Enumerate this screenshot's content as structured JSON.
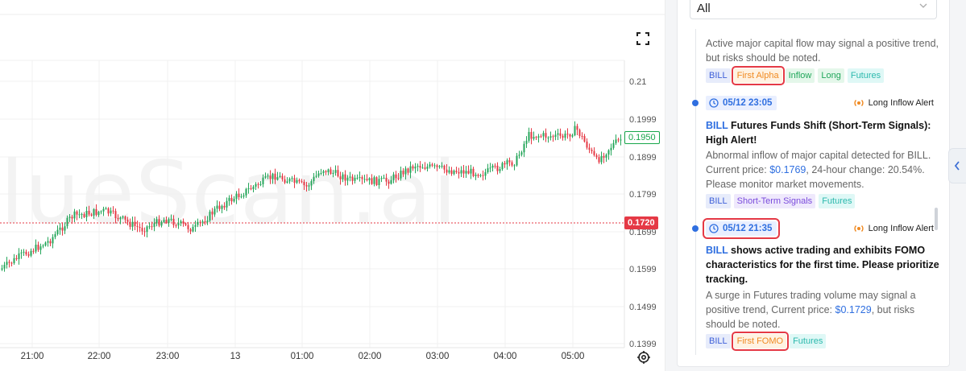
{
  "chart": {
    "price_labels": [
      "0.21",
      "0.1999",
      "0.1899",
      "0.1799",
      "0.1699",
      "0.1599",
      "0.1499",
      "0.1399"
    ],
    "time_labels": [
      "21:00",
      "22:00",
      "23:00",
      "13",
      "01:00",
      "02:00",
      "03:00",
      "04:00",
      "05:00"
    ],
    "current_price": "0.1950",
    "cursor_price": "0.1720",
    "watermark": "lueScan.ai",
    "up_color": "#26a65b",
    "down_color": "#e53945"
  },
  "sidebar": {
    "filter_value": "All",
    "items": [
      {
        "desc": "Active major capital flow may signal a positive trend, but risks should be noted.",
        "tags": [
          "BILL",
          "First Alpha",
          "Inflow",
          "Long",
          "Futures"
        ]
      },
      {
        "time": "05/12 23:05",
        "alert": "Long Inflow Alert",
        "title_symbol": "BILL",
        "title_rest": " Futures Funds Shift (Short-Term Signals): High Alert!",
        "desc_a": "Abnormal inflow of major capital detected for BILL. Current price: ",
        "desc_price": "$0.1769",
        "desc_b": ", 24-hour change: 20.54%. Please monitor market movements.",
        "tags": [
          "BILL",
          "Short-Term Signals",
          "Futures"
        ]
      },
      {
        "time": "05/12 21:35",
        "alert": "Long Inflow Alert",
        "title_symbol": "BILL",
        "title_rest": " shows active trading and exhibits FOMO characteristics for the first time. Please prioritize tracking.",
        "desc_a": "A surge in Futures trading volume may signal a positive trend, Current price: ",
        "desc_price": "$0.1729",
        "desc_b": ", but risks should be noted.",
        "tags": [
          "BILL",
          "First FOMO",
          "Futures"
        ]
      }
    ]
  }
}
